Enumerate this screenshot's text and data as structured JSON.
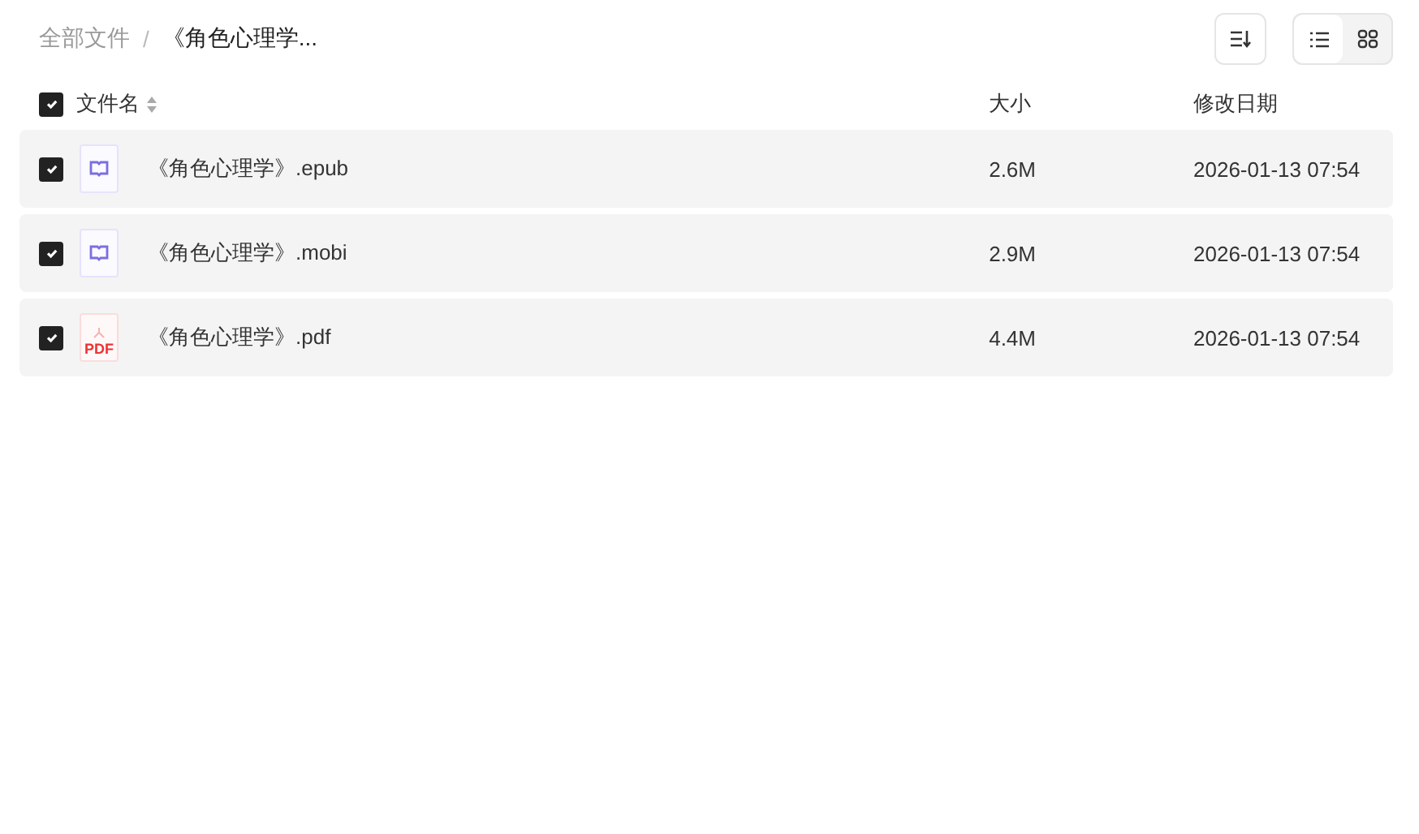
{
  "breadcrumb": [
    {
      "label": "全部文件",
      "current": false
    },
    {
      "label": "《角色心理学...",
      "current": true
    }
  ],
  "breadcrumb_separator": "/",
  "view_modes": [
    {
      "kind": "list",
      "selected": true
    },
    {
      "kind": "grid",
      "selected": false
    }
  ],
  "header": {
    "checked": true,
    "name": "文件名",
    "size": "大小",
    "date": "修改日期"
  },
  "files": [
    {
      "kind": "ebook",
      "name": "《角色心理学》.epub",
      "size": "2.6M",
      "date": "2026-01-13 07:54",
      "checked": true
    },
    {
      "kind": "ebook",
      "name": "《角色心理学》.mobi",
      "size": "2.9M",
      "date": "2026-01-13 07:54",
      "checked": true
    },
    {
      "kind": "pdf",
      "icon_label": "PDF",
      "name": "《角色心理学》.pdf",
      "size": "4.4M",
      "date": "2026-01-13 07:54",
      "checked": true
    }
  ]
}
